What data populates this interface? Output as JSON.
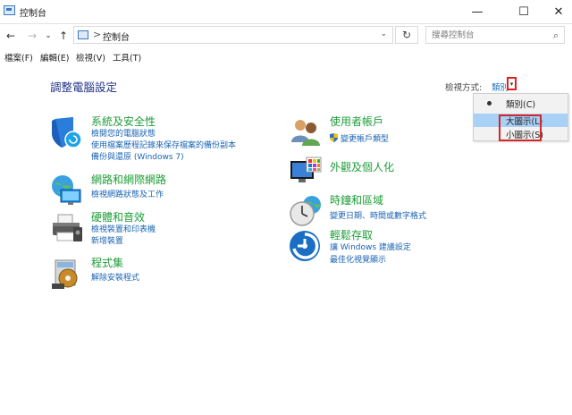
{
  "window": {
    "title": "控制台",
    "minimize_glyph": "—",
    "maximize_glyph": "☐",
    "close_glyph": "✕"
  },
  "address_bar": {
    "breadcrumb": "控制台",
    "separator": ">",
    "dropdown_glyph": "⌄",
    "back_glyph": "←",
    "forward_glyph": "→",
    "recent_glyph": "⌄",
    "up_glyph": "↑",
    "refresh_glyph": "↻"
  },
  "search": {
    "placeholder": "搜尋控制台",
    "icon": "search-icon",
    "glyph": "⌕"
  },
  "menu": {
    "file": "檔案(F)",
    "edit": "編輯(E)",
    "view": "檢視(V)",
    "tools": "工具(T)"
  },
  "page": {
    "title": "調整電腦設定"
  },
  "view_by": {
    "label": "檢視方式:",
    "value": "類別",
    "arrow_glyph": "▾",
    "options": [
      {
        "label": "類別(C)",
        "selected": true
      },
      {
        "label": "大圖示(L)",
        "highlighted": true
      },
      {
        "label": "小圖示(S)"
      }
    ]
  },
  "categories": {
    "security": {
      "title": "系統及安全性",
      "links": [
        "檢閱您的電腦狀態",
        "使用檔案歷程記錄來保存檔案的備份副本",
        "備份與還原 (Windows 7)"
      ],
      "icon": "shield-icon"
    },
    "network": {
      "title": "網路和網際網路",
      "links": [
        "檢視網路狀態及工作"
      ],
      "icon": "network-globe-icon"
    },
    "hardware": {
      "title": "硬體和音效",
      "links": [
        "檢視裝置和印表機",
        "新增裝置"
      ],
      "icon": "printer-icon"
    },
    "programs": {
      "title": "程式集",
      "links": [
        "解除安裝程式"
      ],
      "icon": "programs-disc-icon"
    },
    "accounts": {
      "title": "使用者帳戶",
      "links": [
        "變更帳戶類型"
      ],
      "icon": "users-icon"
    },
    "appearance": {
      "title": "外觀及個人化",
      "links": [],
      "icon": "monitor-palette-icon"
    },
    "clock": {
      "title": "時鐘和區域",
      "links": [
        "變更日期、時間或數字格式"
      ],
      "icon": "clock-globe-icon"
    },
    "ease": {
      "title": "輕鬆存取",
      "links": [
        "讓 Windows 建議設定",
        "最佳化視覺顯示"
      ],
      "icon": "ease-of-access-icon"
    }
  },
  "colors": {
    "category_title": "#1e9e38",
    "link": "#1a64b4",
    "page_title": "#1e3287",
    "highlight_box": "#d02828",
    "selection": "#a9d0f5"
  }
}
